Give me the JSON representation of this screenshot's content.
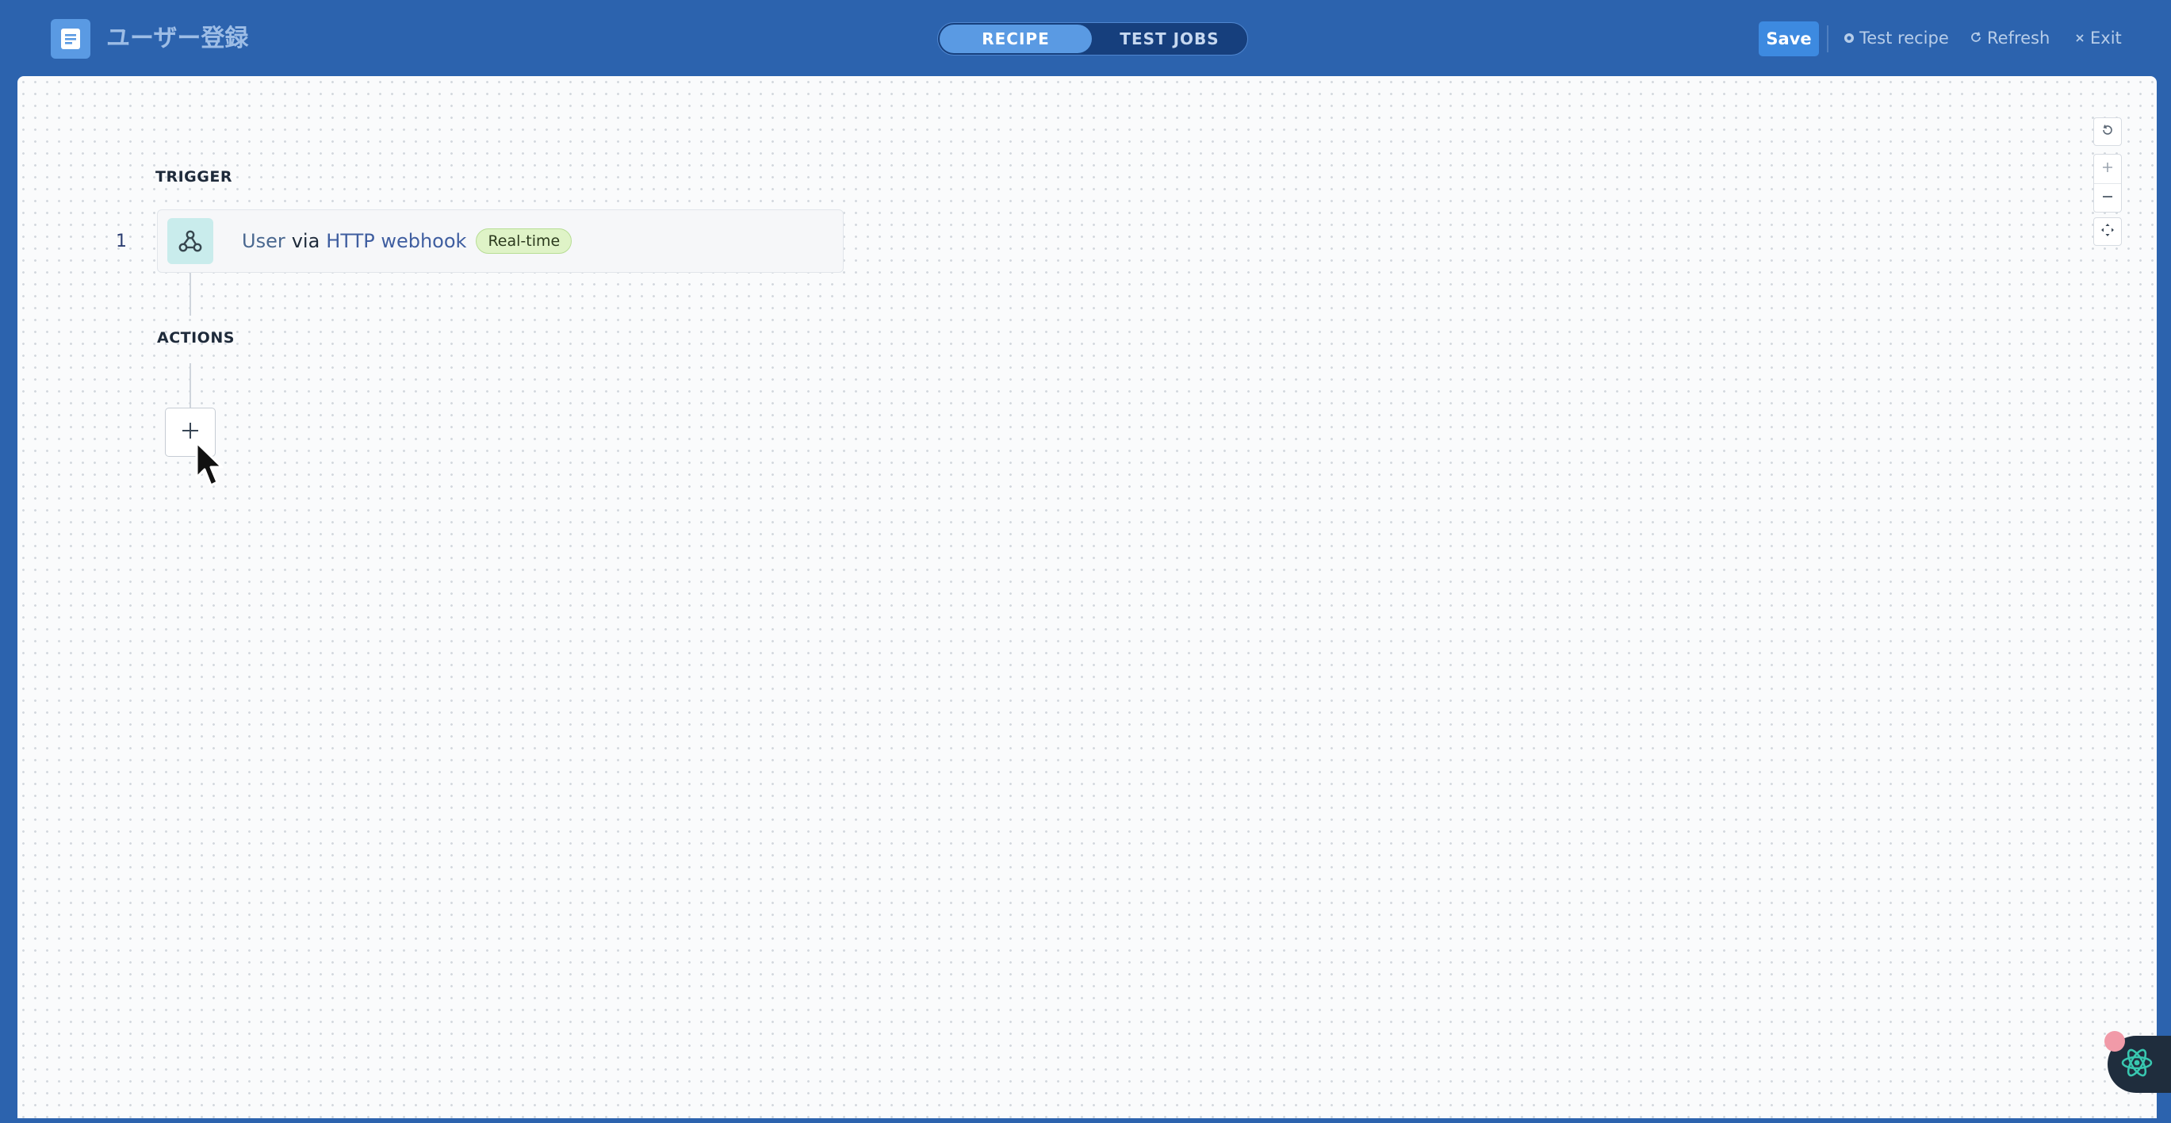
{
  "header": {
    "title": "ユーザー登録",
    "icon": "document-icon",
    "tabs": [
      {
        "label": "RECIPE",
        "active": true
      },
      {
        "label": "TEST JOBS",
        "active": false
      }
    ],
    "save_label": "Save",
    "test_recipe_label": "Test recipe",
    "refresh_label": "Refresh",
    "exit_label": "Exit"
  },
  "canvas": {
    "trigger_label": "TRIGGER",
    "actions_label": "ACTIONS",
    "steps": [
      {
        "number": "1",
        "object": "User",
        "via": "via",
        "app": "HTTP webhook",
        "icon": "webhook-icon",
        "badge": "Real-time"
      }
    ],
    "add_step_icon": "plus-icon"
  },
  "zoom_controls": [
    "reset-zoom-icon",
    "zoom-in-icon",
    "zoom-out-icon",
    "fit-view-icon"
  ],
  "colors": {
    "header_bg": "#2c63ae",
    "tab_active": "#5a9ae3",
    "save_button": "#3d8ae0",
    "badge_bg": "#dff3c7",
    "app_icon_bg": "#c9ecec"
  }
}
